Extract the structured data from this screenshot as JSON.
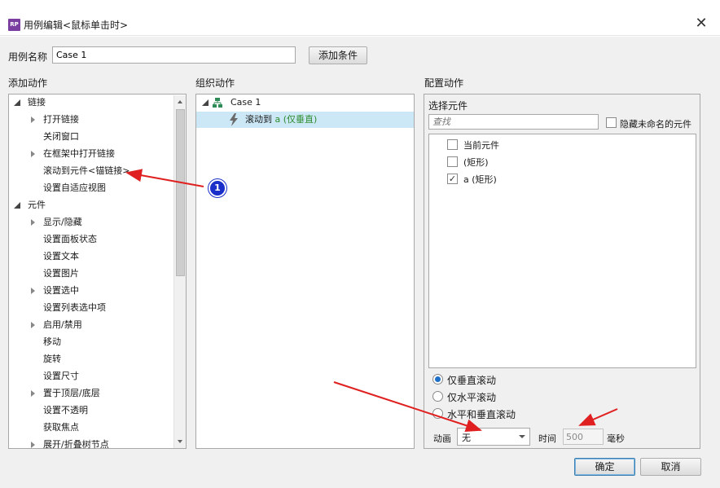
{
  "window": {
    "icon_text": "RP",
    "title": "用例编辑<鼠标单击时>"
  },
  "case_name": {
    "label": "用例名称",
    "value": "Case 1"
  },
  "add_condition_label": "添加条件",
  "add_actions": {
    "header": "添加动作",
    "items": [
      {
        "label": "链接",
        "level": 0,
        "expander": "open"
      },
      {
        "label": "打开链接",
        "level": 1,
        "expander": "closed"
      },
      {
        "label": "关闭窗口",
        "level": 1,
        "expander": "none"
      },
      {
        "label": "在框架中打开链接",
        "level": 1,
        "expander": "closed"
      },
      {
        "label": "滚动到元件<锚链接>",
        "level": 1,
        "expander": "none"
      },
      {
        "label": "设置自适应视图",
        "level": 1,
        "expander": "none"
      },
      {
        "label": "元件",
        "level": 0,
        "expander": "open"
      },
      {
        "label": "显示/隐藏",
        "level": 1,
        "expander": "closed"
      },
      {
        "label": "设置面板状态",
        "level": 1,
        "expander": "none"
      },
      {
        "label": "设置文本",
        "level": 1,
        "expander": "none"
      },
      {
        "label": "设置图片",
        "level": 1,
        "expander": "none"
      },
      {
        "label": "设置选中",
        "level": 1,
        "expander": "closed"
      },
      {
        "label": "设置列表选中项",
        "level": 1,
        "expander": "none"
      },
      {
        "label": "启用/禁用",
        "level": 1,
        "expander": "closed"
      },
      {
        "label": "移动",
        "level": 1,
        "expander": "none"
      },
      {
        "label": "旋转",
        "level": 1,
        "expander": "none"
      },
      {
        "label": "设置尺寸",
        "level": 1,
        "expander": "none"
      },
      {
        "label": "置于顶层/底层",
        "level": 1,
        "expander": "closed"
      },
      {
        "label": "设置不透明",
        "level": 1,
        "expander": "none"
      },
      {
        "label": "获取焦点",
        "level": 1,
        "expander": "none"
      },
      {
        "label": "展开/折叠树节点",
        "level": 1,
        "expander": "closed"
      }
    ]
  },
  "organize_actions": {
    "header": "组织动作",
    "case_label": "Case 1",
    "action_prefix": "滚动到 ",
    "action_detail": "a (仅垂直)",
    "action_detail_color": "#2e8b2e"
  },
  "configure_actions": {
    "header": "配置动作",
    "select_widget_label": "选择元件",
    "search_placeholder": "查找",
    "hide_unnamed_label": "隐藏未命名的元件",
    "widgets": [
      {
        "label": "当前元件",
        "checked": false
      },
      {
        "label": "(矩形)",
        "checked": false
      },
      {
        "label": "a (矩形)",
        "checked": true
      }
    ],
    "scroll_options": [
      {
        "label": "仅垂直滚动",
        "checked": true
      },
      {
        "label": "仅水平滚动",
        "checked": false
      },
      {
        "label": "水平和垂直滚动",
        "checked": false
      }
    ],
    "animation_label": "动画",
    "animation_value": "无",
    "time_label": "时间",
    "time_value": "500",
    "time_unit": "毫秒"
  },
  "footer": {
    "ok_label": "确定",
    "cancel_label": "取消"
  },
  "annotation_badge": "1",
  "colors": {
    "selection": "#cce8f6",
    "annotation_arrow": "#e02020",
    "badge": "#1a2fc9"
  }
}
